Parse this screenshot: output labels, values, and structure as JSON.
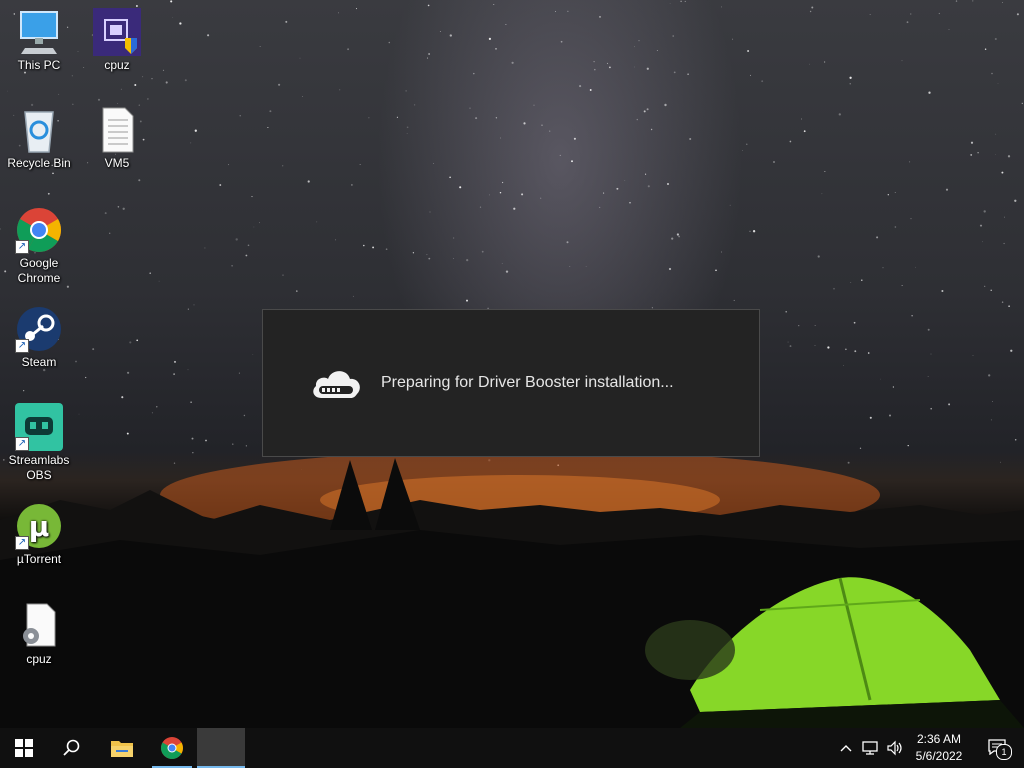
{
  "desktop": {
    "icons": [
      {
        "label": "This PC",
        "icon": "this-pc-icon",
        "shortcut": false
      },
      {
        "label": "cpuz",
        "icon": "cpuz-app-icon",
        "shortcut": false
      },
      {
        "label": "Recycle Bin",
        "icon": "recycle-bin-icon",
        "shortcut": false
      },
      {
        "label": "VM5",
        "icon": "text-file-icon",
        "shortcut": false
      },
      {
        "label": "Google Chrome",
        "icon": "chrome-icon",
        "shortcut": true
      },
      {
        "label": "Steam",
        "icon": "steam-icon",
        "shortcut": true
      },
      {
        "label": "Streamlabs OBS",
        "icon": "streamlabs-obs-icon",
        "shortcut": true
      },
      {
        "label": "µTorrent",
        "icon": "utorrent-icon",
        "shortcut": true
      },
      {
        "label": "cpuz",
        "icon": "config-file-icon",
        "shortcut": false
      }
    ]
  },
  "dialog": {
    "message": "Preparing for Driver Booster installation..."
  },
  "taskbar": {
    "items": [
      "start-icon",
      "search-icon",
      "file-explorer-icon",
      "chrome-icon",
      "installer-task-icon"
    ],
    "tray": {
      "clock_time": "2:36 AM",
      "clock_date": "5/6/2022",
      "notification_count": "1"
    }
  },
  "colors": {
    "taskbar_bg": "#101010",
    "dialog_bg": "#232323",
    "accent": "#76b9ed",
    "tent_green": "#7ed321"
  }
}
